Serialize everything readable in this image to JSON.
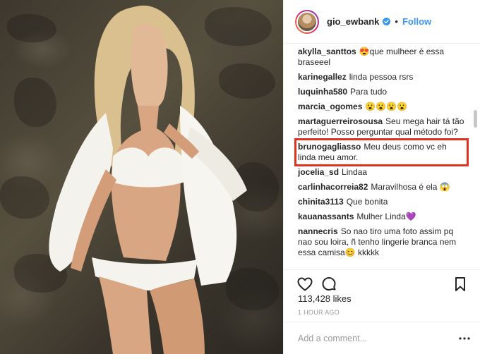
{
  "header": {
    "username": "gio_ewbank",
    "separator": "•",
    "follow_label": "Follow",
    "verified_icon": "verified-badge-icon"
  },
  "comments": [
    {
      "user": "akylla_santtos",
      "text": "😍que mulheer é essa braseeel"
    },
    {
      "user": "karinegallez",
      "text": "linda pessoa rsrs"
    },
    {
      "user": "luquinha580",
      "text": "Para tudo"
    },
    {
      "user": "marcia_ogomes",
      "text": "😮😮😮😮"
    },
    {
      "user": "martaguerreirosousa",
      "text": "Seu mega hair tá tão perfeito! Posso perguntar qual método foi?"
    },
    {
      "user": "brunogagliasso",
      "text": "Meu deus como vc eh linda meu amor."
    },
    {
      "user": "jocelia_sd",
      "text": "Lindaa"
    },
    {
      "user": "carlinhacorreia82",
      "text": "Maravilhosa é ela 😱"
    },
    {
      "user": "chinita3113",
      "text": "Que bonita"
    },
    {
      "user": "kauanassants",
      "text": "Mulher Linda💜"
    },
    {
      "user": "nannecris",
      "text": "So nao tiro uma foto assim pq nao sou loira, ñ tenho lingerie branca nem essa camisa😊 kkkkk"
    }
  ],
  "highlight_color": "#e0301e",
  "accent_color": "#3897f0",
  "actions": {
    "like_icon": "heart-icon",
    "comment_icon": "comment-bubble-icon",
    "save_icon": "bookmark-icon"
  },
  "likes": "113,428 likes",
  "timestamp": "1 HOUR AGO",
  "comment_input": {
    "placeholder": "Add a comment...",
    "value": ""
  },
  "more_icon": "more-options-icon"
}
